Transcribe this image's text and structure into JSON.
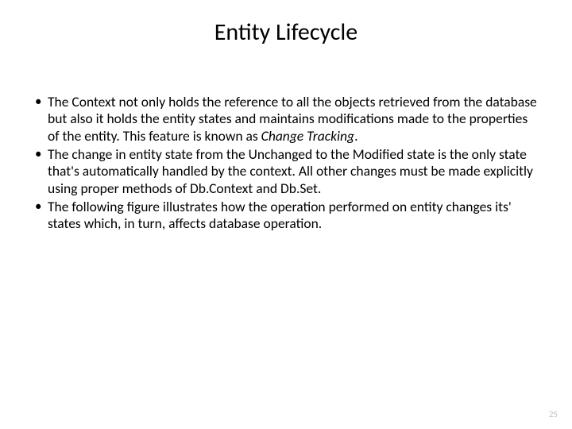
{
  "slide": {
    "title": "Entity Lifecycle",
    "bullets": [
      {
        "pre": "The Context not only holds the reference to all the objects retrieved from the database but also it holds the entity states and maintains modifications made to the properties of the entity. This feature is known as ",
        "em": "Change Tracking",
        "post": "."
      },
      {
        "pre": "The change in entity state from the Unchanged to the Modified state is the only state that's automatically handled by the context. All other changes must be made explicitly using proper methods of Db.Context and Db.Set.",
        "em": "",
        "post": ""
      },
      {
        "pre": "The following figure illustrates how the operation performed on entity changes its' states which, in turn, affects database operation.",
        "em": "",
        "post": ""
      }
    ],
    "page_number": "25"
  }
}
